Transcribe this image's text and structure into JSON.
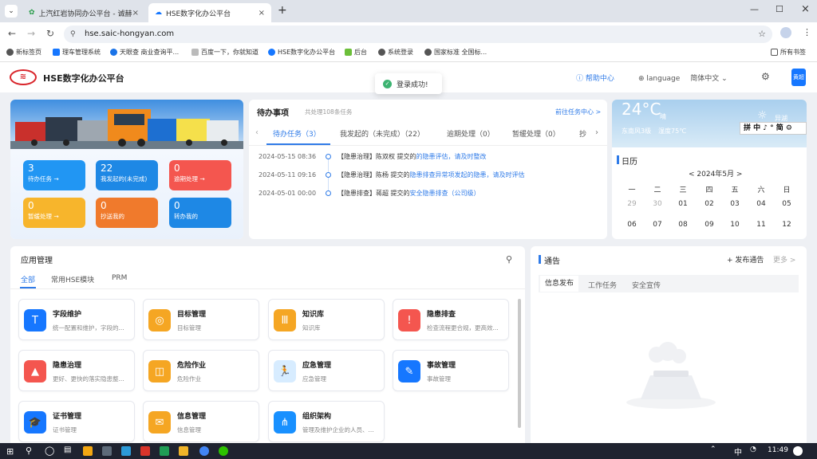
{
  "browser": {
    "tabs": [
      {
        "title": "上汽红岩协同办公平台 - 诚赫",
        "active": false
      },
      {
        "title": "HSE数字化办公平台",
        "active": true
      }
    ],
    "url": "hse.saic-hongyan.com",
    "bookmarks": [
      "新标签页",
      "理车管理系统",
      "天眼查 商业查询平...",
      "百度一下，你就知道",
      "HSE数字化办公平台",
      "后台",
      "系统登录",
      "国家标准 全国标...",
      "所有书签"
    ]
  },
  "header": {
    "app_title": "HSE数字化办公平台",
    "help": "帮助中心",
    "language_label": "language",
    "language_value": "简体中文",
    "avatar_text": "黄超"
  },
  "toast": "登录成功!",
  "stats": [
    {
      "count": "3",
      "label": "待办任务 →",
      "color": "#2196f3"
    },
    {
      "count": "22",
      "label": "我发起的(未完成)",
      "color": "#1e88e5"
    },
    {
      "count": "0",
      "label": "逾期处理 →",
      "color": "#f4564f"
    },
    {
      "count": "0",
      "label": "暂缓处理 →",
      "color": "#f7b52c"
    },
    {
      "count": "0",
      "label": "抄送我的",
      "color": "#f07a2c"
    },
    {
      "count": "0",
      "label": "转办我的",
      "color": "#1e88e5"
    }
  ],
  "todo": {
    "title": "待办事项",
    "subtitle": "共处理108条任务",
    "more": "前往任务中心 >",
    "tabs": [
      "待办任务（3）",
      "我发起的（未完成）（22）",
      "逾期处理（0）",
      "暂缓处理（0）",
      "抄"
    ],
    "items": [
      {
        "date": "2024-05-15 08:36",
        "tag": "【隐患治理】",
        "who": "陈双权 提交的",
        "link": "的隐患评估，请及时整改"
      },
      {
        "date": "2024-05-11 09:16",
        "tag": "【隐患治理】",
        "who": "陈杨 提交的",
        "link": "隐患排查异常项发起的隐患，请及时评估"
      },
      {
        "date": "2024-05-01 00:00",
        "tag": "【隐患排查】",
        "who": "蒋超 提交的",
        "link": "安全隐患排查（公司级）"
      }
    ]
  },
  "weather": {
    "temp": "24°C",
    "cond": "晴",
    "wind": "东南风3级",
    "humidity": "湿度75℃",
    "city": "异湖"
  },
  "ime": "拼 中 ♪ ° 简 ⚙",
  "calendar": {
    "title": "日历",
    "month": "< 2024年5月 >",
    "weekdays": [
      "一",
      "二",
      "三",
      "四",
      "五",
      "六",
      "日"
    ],
    "rows": [
      [
        "29",
        "30",
        "01",
        "02",
        "03",
        "04",
        "05"
      ],
      [
        "06",
        "07",
        "08",
        "09",
        "10",
        "11",
        "12"
      ]
    ]
  },
  "apps": {
    "title": "应用管理",
    "tabs": [
      "全部",
      "常用HSE模块",
      "PRM"
    ],
    "items": [
      {
        "name": "字段维护",
        "desc": "统一配置和维护，字段的...",
        "icon": "T",
        "color": "#1677ff"
      },
      {
        "name": "目标管理",
        "desc": "目标管理",
        "icon": "◎",
        "color": "#f5a623"
      },
      {
        "name": "知识库",
        "desc": "知识库",
        "icon": "Ⅲ",
        "color": "#f5a623"
      },
      {
        "name": "隐患排查",
        "desc": "检查流程更合规，更高效...",
        "icon": "!",
        "color": "#f4564f"
      },
      {
        "name": "隐患治理",
        "desc": "更好、更快的落实隐患整...",
        "icon": "▲",
        "color": "#f4564f"
      },
      {
        "name": "危险作业",
        "desc": "危险作业",
        "icon": "◫",
        "color": "#f5a623"
      },
      {
        "name": "应急管理",
        "desc": "应急管理",
        "icon": "🏃",
        "color": "#1890ff"
      },
      {
        "name": "事故管理",
        "desc": "事故管理",
        "icon": "✎",
        "color": "#1677ff"
      },
      {
        "name": "证书管理",
        "desc": "证书管理",
        "icon": "🎓",
        "color": "#1677ff"
      },
      {
        "name": "信息管理",
        "desc": "信息管理",
        "icon": "✉",
        "color": "#f5a623"
      },
      {
        "name": "组织架构",
        "desc": "管理及维护企业的人员、...",
        "icon": "⋔",
        "color": "#1890ff"
      }
    ]
  },
  "notice": {
    "title": "通告",
    "publish": "+ 发布通告",
    "more": "更多 >",
    "tabs": [
      "信息发布",
      "工作任务",
      "安全宣传"
    ]
  },
  "taskbar": {
    "time": "11:49",
    "lang": "中"
  }
}
